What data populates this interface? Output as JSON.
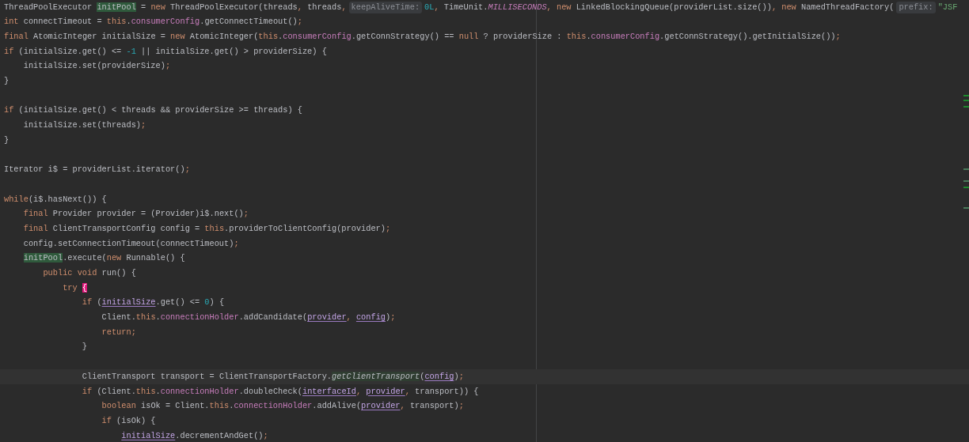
{
  "editor": {
    "lines": [
      {
        "tokens": [
          {
            "t": "ThreadPoolExecutor ",
            "kind": "plain"
          },
          {
            "t": "initPool",
            "kind": "usage"
          },
          {
            "t": " = ",
            "kind": "plain"
          },
          {
            "t": "new",
            "kind": "keyword"
          },
          {
            "t": " ThreadPoolExecutor(threads",
            "kind": "plain"
          },
          {
            "t": ",",
            "kind": "keyword"
          },
          {
            "t": " threads",
            "kind": "plain"
          },
          {
            "t": ",",
            "kind": "keyword"
          },
          {
            "t": "keepAliveTime:",
            "kind": "hint"
          },
          {
            "t": "0L",
            "kind": "number"
          },
          {
            "t": ",",
            "kind": "keyword"
          },
          {
            "t": " TimeUnit.",
            "kind": "plain"
          },
          {
            "t": "MILLISECONDS",
            "kind": "constant"
          },
          {
            "t": ",",
            "kind": "keyword"
          },
          {
            "t": " new",
            "kind": "keyword"
          },
          {
            "t": " LinkedBlockingQueue(providerList.size())",
            "kind": "plain"
          },
          {
            "t": ",",
            "kind": "keyword"
          },
          {
            "t": " new",
            "kind": "keyword"
          },
          {
            "t": " NamedThreadFactory(",
            "kind": "plain"
          },
          {
            "t": "prefix:",
            "kind": "hint"
          },
          {
            "t": "\"JSF",
            "kind": "string"
          }
        ]
      },
      {
        "tokens": [
          {
            "t": "int",
            "kind": "keyword"
          },
          {
            "t": " connectTimeout = ",
            "kind": "plain"
          },
          {
            "t": "this",
            "kind": "keyword"
          },
          {
            "t": ".",
            "kind": "plain"
          },
          {
            "t": "consumerConfig",
            "kind": "field"
          },
          {
            "t": ".getConnectTimeout()",
            "kind": "plain"
          },
          {
            "t": ";",
            "kind": "keyword"
          }
        ]
      },
      {
        "tokens": [
          {
            "t": "final",
            "kind": "keyword"
          },
          {
            "t": " AtomicInteger initialSize = ",
            "kind": "plain"
          },
          {
            "t": "new",
            "kind": "keyword"
          },
          {
            "t": " AtomicInteger(",
            "kind": "plain"
          },
          {
            "t": "this",
            "kind": "keyword"
          },
          {
            "t": ".",
            "kind": "plain"
          },
          {
            "t": "consumerConfig",
            "kind": "field"
          },
          {
            "t": ".getConnStrategy() == ",
            "kind": "plain"
          },
          {
            "t": "null",
            "kind": "keyword"
          },
          {
            "t": " ? providerSize : ",
            "kind": "plain"
          },
          {
            "t": "this",
            "kind": "keyword"
          },
          {
            "t": ".",
            "kind": "plain"
          },
          {
            "t": "consumerConfig",
            "kind": "field"
          },
          {
            "t": ".getConnStrategy().getInitialSize())",
            "kind": "plain"
          },
          {
            "t": ";",
            "kind": "keyword"
          }
        ]
      },
      {
        "tokens": [
          {
            "t": "if",
            "kind": "keyword"
          },
          {
            "t": " (initialSize.get() <= ",
            "kind": "plain"
          },
          {
            "t": "-1",
            "kind": "number"
          },
          {
            "t": " || initialSize.get() > providerSize) {",
            "kind": "plain"
          }
        ],
        "children": [
          {
            "tokens": [
              {
                "t": "initialSize.set(providerSize)",
                "kind": "plain"
              },
              {
                "t": ";",
                "kind": "keyword"
              }
            ]
          }
        ]
      },
      {
        "tokens": [
          {
            "t": "}",
            "kind": "plain"
          }
        ]
      },
      {
        "blank_before": true,
        "tokens": [
          {
            "t": "if",
            "kind": "keyword"
          },
          {
            "t": " (initialSize.get() < threads && providerSize >= threads) {",
            "kind": "plain"
          }
        ],
        "children": [
          {
            "tokens": [
              {
                "t": "initialSize.set(threads)",
                "kind": "plain"
              },
              {
                "t": ";",
                "kind": "keyword"
              }
            ]
          }
        ]
      },
      {
        "tokens": [
          {
            "t": "}",
            "kind": "plain"
          }
        ]
      },
      {
        "blank_before": true,
        "tokens": [
          {
            "t": "Iterator i$ = providerList.iterator()",
            "kind": "plain"
          },
          {
            "t": ";",
            "kind": "keyword"
          }
        ]
      },
      {
        "blank_before": true,
        "tokens": [
          {
            "t": "while",
            "kind": "keyword"
          },
          {
            "t": "(i$.hasNext()) {",
            "kind": "plain"
          }
        ],
        "children": [
          {
            "tokens": [
              {
                "t": "final",
                "kind": "keyword"
              },
              {
                "t": " Provider provider = (Provider)i$.next()",
                "kind": "plain"
              },
              {
                "t": ";",
                "kind": "keyword"
              }
            ]
          },
          {
            "tokens": [
              {
                "t": "final",
                "kind": "keyword"
              },
              {
                "t": " ClientTransportConfig config = ",
                "kind": "plain"
              },
              {
                "t": "this",
                "kind": "keyword"
              },
              {
                "t": ".providerToClientConfig(provider)",
                "kind": "plain"
              },
              {
                "t": ";",
                "kind": "keyword"
              }
            ]
          },
          {
            "tokens": [
              {
                "t": "config.setConnectionTimeout(connectTimeout)",
                "kind": "plain"
              },
              {
                "t": ";",
                "kind": "keyword"
              }
            ]
          },
          {
            "tokens": [
              {
                "t": "initPool",
                "kind": "usage"
              },
              {
                "t": ".execute(",
                "kind": "plain"
              },
              {
                "t": "new",
                "kind": "keyword"
              },
              {
                "t": " Runnable() {",
                "kind": "plain"
              }
            ],
            "children": [
              {
                "tokens": [
                  {
                    "t": "public void",
                    "kind": "keyword"
                  },
                  {
                    "t": " run() {",
                    "kind": "plain"
                  }
                ],
                "children": [
                  {
                    "tokens": [
                      {
                        "t": "try ",
                        "kind": "keyword"
                      },
                      {
                        "t": "{",
                        "kind": "brace_match"
                      }
                    ],
                    "children": [
                      {
                        "tokens": [
                          {
                            "t": "if",
                            "kind": "keyword"
                          },
                          {
                            "t": " (",
                            "kind": "plain"
                          },
                          {
                            "t": "initialSize",
                            "kind": "captured"
                          },
                          {
                            "t": ".get() <= ",
                            "kind": "plain"
                          },
                          {
                            "t": "0",
                            "kind": "number"
                          },
                          {
                            "t": ") {",
                            "kind": "plain"
                          }
                        ],
                        "children": [
                          {
                            "tokens": [
                              {
                                "t": "Client.",
                                "kind": "plain"
                              },
                              {
                                "t": "this",
                                "kind": "keyword"
                              },
                              {
                                "t": ".",
                                "kind": "plain"
                              },
                              {
                                "t": "connectionHolder",
                                "kind": "field"
                              },
                              {
                                "t": ".addCandidate(",
                                "kind": "plain"
                              },
                              {
                                "t": "provider",
                                "kind": "captured"
                              },
                              {
                                "t": ", ",
                                "kind": "keyword"
                              },
                              {
                                "t": "config",
                                "kind": "captured"
                              },
                              {
                                "t": ")",
                                "kind": "plain"
                              },
                              {
                                "t": ";",
                                "kind": "keyword"
                              }
                            ]
                          },
                          {
                            "tokens": [
                              {
                                "t": "return;",
                                "kind": "keyword"
                              }
                            ]
                          }
                        ]
                      },
                      {
                        "tokens": [
                          {
                            "t": "}",
                            "kind": "plain"
                          }
                        ]
                      },
                      {
                        "blank_before": true,
                        "current": true,
                        "tokens": [
                          {
                            "t": "ClientTransport transport = ClientTransportFactory.",
                            "kind": "plain"
                          },
                          {
                            "t": "getClientTransport",
                            "kind": "static_call"
                          },
                          {
                            "t": "(",
                            "kind": "plain"
                          },
                          {
                            "t": "config",
                            "kind": "captured"
                          },
                          {
                            "t": ")",
                            "kind": "plain"
                          },
                          {
                            "t": ";",
                            "kind": "keyword"
                          }
                        ]
                      },
                      {
                        "tokens": [
                          {
                            "t": "if",
                            "kind": "keyword"
                          },
                          {
                            "t": " (Client.",
                            "kind": "plain"
                          },
                          {
                            "t": "this",
                            "kind": "keyword"
                          },
                          {
                            "t": ".",
                            "kind": "plain"
                          },
                          {
                            "t": "connectionHolder",
                            "kind": "field"
                          },
                          {
                            "t": ".doubleCheck(",
                            "kind": "plain"
                          },
                          {
                            "t": "interfaceId",
                            "kind": "captured"
                          },
                          {
                            "t": ", ",
                            "kind": "keyword"
                          },
                          {
                            "t": "provider",
                            "kind": "captured"
                          },
                          {
                            "t": ",",
                            "kind": "keyword"
                          },
                          {
                            "t": " transport)) {",
                            "kind": "plain"
                          }
                        ],
                        "children": [
                          {
                            "tokens": [
                              {
                                "t": "boolean",
                                "kind": "keyword"
                              },
                              {
                                "t": " isOk = Client.",
                                "kind": "plain"
                              },
                              {
                                "t": "this",
                                "kind": "keyword"
                              },
                              {
                                "t": ".",
                                "kind": "plain"
                              },
                              {
                                "t": "connectionHolder",
                                "kind": "field"
                              },
                              {
                                "t": ".addAlive(",
                                "kind": "plain"
                              },
                              {
                                "t": "provider",
                                "kind": "captured"
                              },
                              {
                                "t": ",",
                                "kind": "keyword"
                              },
                              {
                                "t": " transport)",
                                "kind": "plain"
                              },
                              {
                                "t": ";",
                                "kind": "keyword"
                              }
                            ]
                          },
                          {
                            "tokens": [
                              {
                                "t": "if",
                                "kind": "keyword"
                              },
                              {
                                "t": " (isOk) {",
                                "kind": "plain"
                              }
                            ],
                            "children": [
                              {
                                "tokens": [
                                  {
                                    "t": "initialSize",
                                    "kind": "captured"
                                  },
                                  {
                                    "t": ".decrementAndGet()",
                                    "kind": "plain"
                                  },
                                  {
                                    "t": ";",
                                    "kind": "keyword"
                                  }
                                ]
                              }
                            ]
                          }
                        ]
                      }
                    ]
                  }
                ]
              }
            ]
          }
        ]
      }
    ]
  }
}
